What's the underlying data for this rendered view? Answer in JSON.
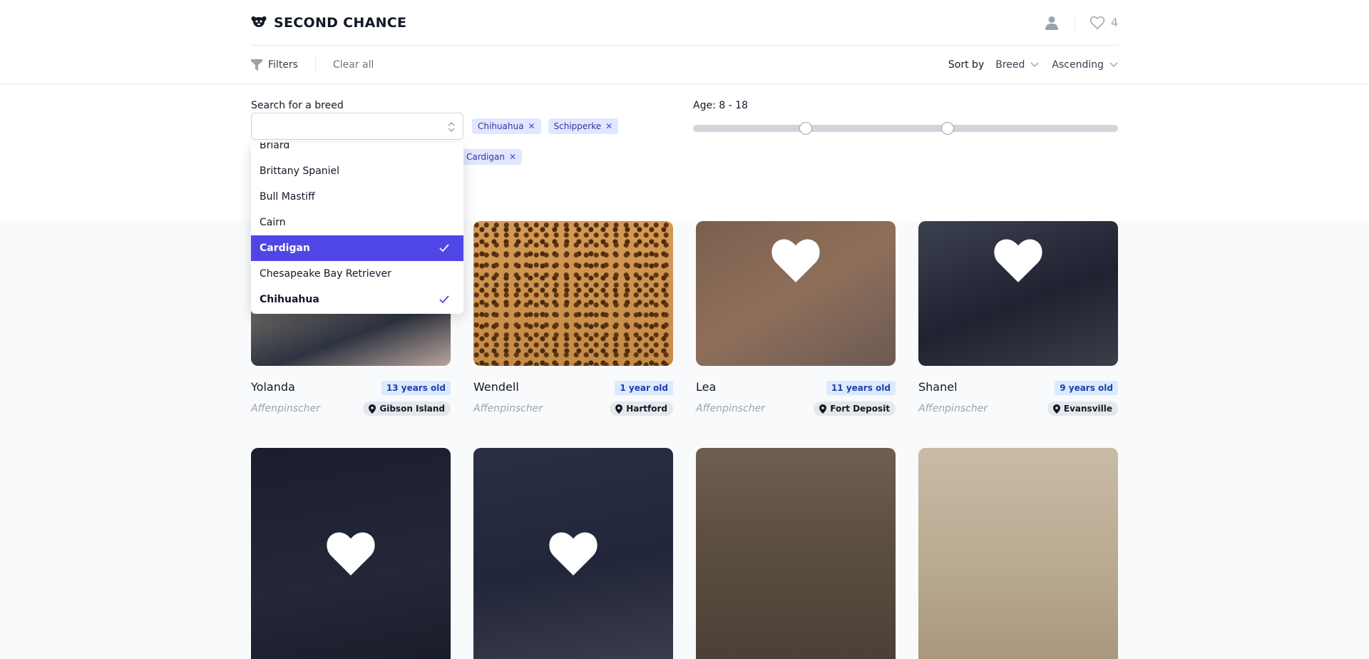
{
  "header": {
    "brand_title": "SECOND CHANCE",
    "favorites_count": "4"
  },
  "toolbar": {
    "filters_label": "Filters",
    "clear_label": "Clear all",
    "sort_label": "Sort by",
    "sort_field": "Breed",
    "sort_order": "Ascending"
  },
  "filters": {
    "search_label": "Search for a breed",
    "search_value": "",
    "selected_breeds": [
      "Chihuahua",
      "Schipperke",
      "Cardigan"
    ],
    "age_label": "Age: 8 - 18",
    "age_min": 8,
    "age_max": 18,
    "breed_options": [
      {
        "label": "Briard",
        "state": "normal"
      },
      {
        "label": "Brittany Spaniel",
        "state": "normal"
      },
      {
        "label": "Bull Mastiff",
        "state": "normal"
      },
      {
        "label": "Cairn",
        "state": "normal"
      },
      {
        "label": "Cardigan",
        "state": "active-selected"
      },
      {
        "label": "Chesapeake Bay Retriever",
        "state": "normal"
      },
      {
        "label": "Chihuahua",
        "state": "selected"
      }
    ]
  },
  "dogs": [
    {
      "name": "Yolanda",
      "age": "13 years old",
      "breed": "Affenpinscher",
      "location": "Gibson Island"
    },
    {
      "name": "Wendell",
      "age": "1 year old",
      "breed": "Affenpinscher",
      "location": "Hartford"
    },
    {
      "name": "Lea",
      "age": "11 years old",
      "breed": "Affenpinscher",
      "location": "Fort Deposit"
    },
    {
      "name": "Shanel",
      "age": "9 years old",
      "breed": "Affenpinscher",
      "location": "Evansville"
    },
    {
      "name": "",
      "age": "",
      "breed": "",
      "location": ""
    },
    {
      "name": "",
      "age": "",
      "breed": "",
      "location": ""
    },
    {
      "name": "",
      "age": "",
      "breed": "",
      "location": ""
    },
    {
      "name": "",
      "age": "",
      "breed": "",
      "location": ""
    }
  ],
  "colors": {
    "accent": "#4f46e5",
    "chip_bg": "#e0e7ff",
    "age_badge_bg": "#dbeafe"
  }
}
